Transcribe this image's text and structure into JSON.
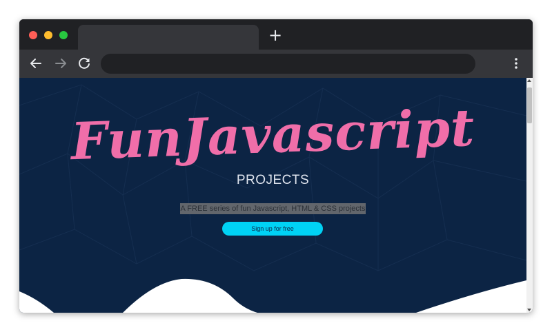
{
  "browser": {
    "new_tab_label": "+",
    "colors": {
      "frame": "#202124",
      "toolbar": "#35363a",
      "omnibox": "#202124"
    },
    "icons": [
      "back-arrow-icon",
      "forward-arrow-icon",
      "reload-icon",
      "menu-dots-icon"
    ]
  },
  "hero": {
    "logo": "FunJavascript",
    "subtitle": "PROJECTS",
    "tagline": "A FREE series of fun Javascript, HTML & CSS projects",
    "cta_label": "Sign up for free",
    "colors": {
      "background": "#0c2444",
      "logo": "#f06ea9",
      "cta": "#00d2f5"
    }
  }
}
